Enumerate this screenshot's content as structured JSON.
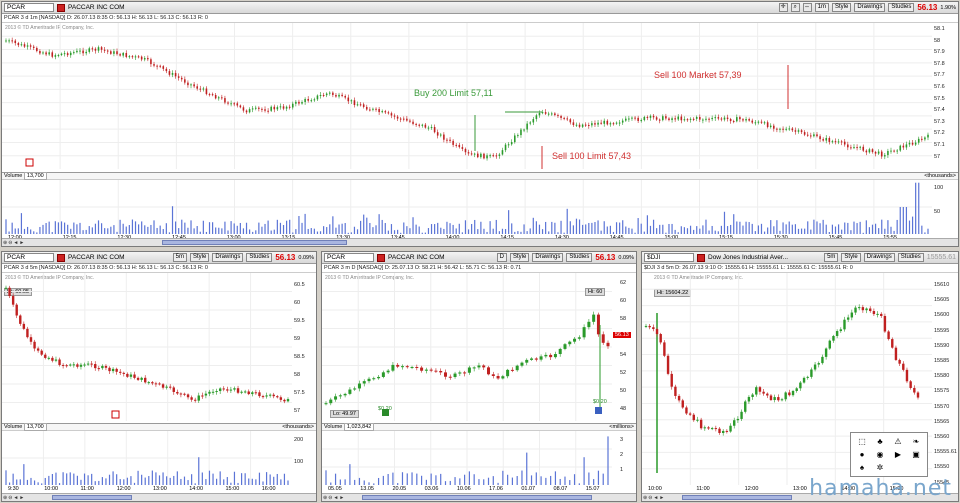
{
  "top": {
    "symbol": "PCAR",
    "company": "PACCAR INC COM",
    "period": "1m",
    "style_label": "Style",
    "drawings_label": "Drawings",
    "studies_label": "Studies",
    "last": "56.13",
    "pct": "1.90%",
    "info": "PCAR 3 d 1m [NASDAQ]  D: 26.07.13 8:35  O: 56.13  H: 56.13  L: 56.13  C: 56.13  R: 0",
    "copyright": "2013 © TD Ameritrade IP Company, Inc.",
    "y_labels": [
      "58.1",
      "58",
      "57.9",
      "57.8",
      "57.7",
      "57.6",
      "57.5",
      "57.4",
      "57.3",
      "57.2",
      "57.1",
      "57"
    ],
    "annotations": {
      "buy": "Buy 200 Limit 57,11",
      "sell_mkt": "Sell 100 Market 57,39",
      "sell_lim": "Sell 100 Limit 57,43"
    },
    "volume_label": "Volume",
    "volume_value": "13,700",
    "volume_unit": "<thousands>",
    "vol_y": [
      "100",
      "50"
    ],
    "x_labels": [
      "12:00",
      "12:15",
      "12:30",
      "12:45",
      "13:00",
      "13:15",
      "13:30",
      "13:45",
      "14:00",
      "14:15",
      "14:30",
      "14:45",
      "15:00",
      "15:15",
      "15:30",
      "15:45",
      "15:55"
    ]
  },
  "left": {
    "symbol": "PCAR",
    "company": "PACCAR INC COM",
    "period": "5m",
    "style_label": "Style",
    "drawings_label": "Drawings",
    "studies_label": "Studies",
    "last": "56.13",
    "pct": "0.09%",
    "info": "PCAR 3 d 5m [NASDAQ]  D: 26.07.13 8:35  O: 56.13  H: 56.13  L: 56.13  C: 56.13  R: 0",
    "copyright": "2013 © TD Ameritrade IP Company, Inc.",
    "hi": "Hi: 60.05",
    "y_labels": [
      "60.5",
      "60",
      "59.5",
      "59",
      "58.5",
      "58",
      "57.5",
      "57"
    ],
    "volume_label": "Volume",
    "volume_value": "13,700",
    "volume_unit": "<thousands>",
    "vol_y": [
      "200",
      "100"
    ],
    "x_labels": [
      "9:30",
      "10:00",
      "11:00",
      "12:00",
      "13:00",
      "14:00",
      "15:00",
      "16:00"
    ]
  },
  "mid": {
    "symbol": "PCAR",
    "company": "PACCAR INC COM",
    "period": "D",
    "style_label": "Style",
    "drawings_label": "Drawings",
    "studies_label": "Studies",
    "last": "56.13",
    "pct": "0.09%",
    "info": "PCAR 3 m D [NASDAQ]  D: 25.07.13  O: 58.21  H: 56.42  L: 55.71  C: 56.13  R: 0.71",
    "copyright": "2013 © TD Ameritrade IP Company, Inc.",
    "hi": "Hi: 60",
    "lo": "Lo: 49.97",
    "pricetag": "56.13",
    "div1": "$0.20",
    "div2": "$0.20",
    "y_labels": [
      "62",
      "60",
      "58",
      "56",
      "54",
      "52",
      "50",
      "48"
    ],
    "volume_label": "Volume",
    "volume_value": "1,023,842",
    "volume_unit": "<millions>",
    "vol_y": [
      "3",
      "2",
      "1"
    ],
    "x_labels": [
      "05.05",
      "13.05",
      "20.05",
      "03.06",
      "10.06",
      "17.06",
      "01.07",
      "08.07",
      "15.07"
    ]
  },
  "right": {
    "symbol": "$DJI",
    "company": "Dow Jones Industrial Aver...",
    "period": "5m",
    "style_label": "Style",
    "drawings_label": "Drawings",
    "studies_label": "Studies",
    "last": "15555.61",
    "info": "$DJI 3 d 5m  D: 26.07.13 9:10  O: 15555.61  H: 15555.61  L: 15555.61  C: 15555.61  R: 0",
    "copyright": "2013 © TD Ameritrade IP Company, Inc.",
    "hi": "Hi: 15604.22",
    "y_labels": [
      "15610",
      "15605",
      "15600",
      "15595",
      "15590",
      "15585",
      "15580",
      "15575",
      "15570",
      "15565",
      "15560",
      "15555.61",
      "15550",
      "15545"
    ],
    "x_labels": [
      "10:00",
      "11:00",
      "12:00",
      "13:00",
      "14:00",
      "15:00"
    ]
  },
  "watermark": "hamaha.net"
}
